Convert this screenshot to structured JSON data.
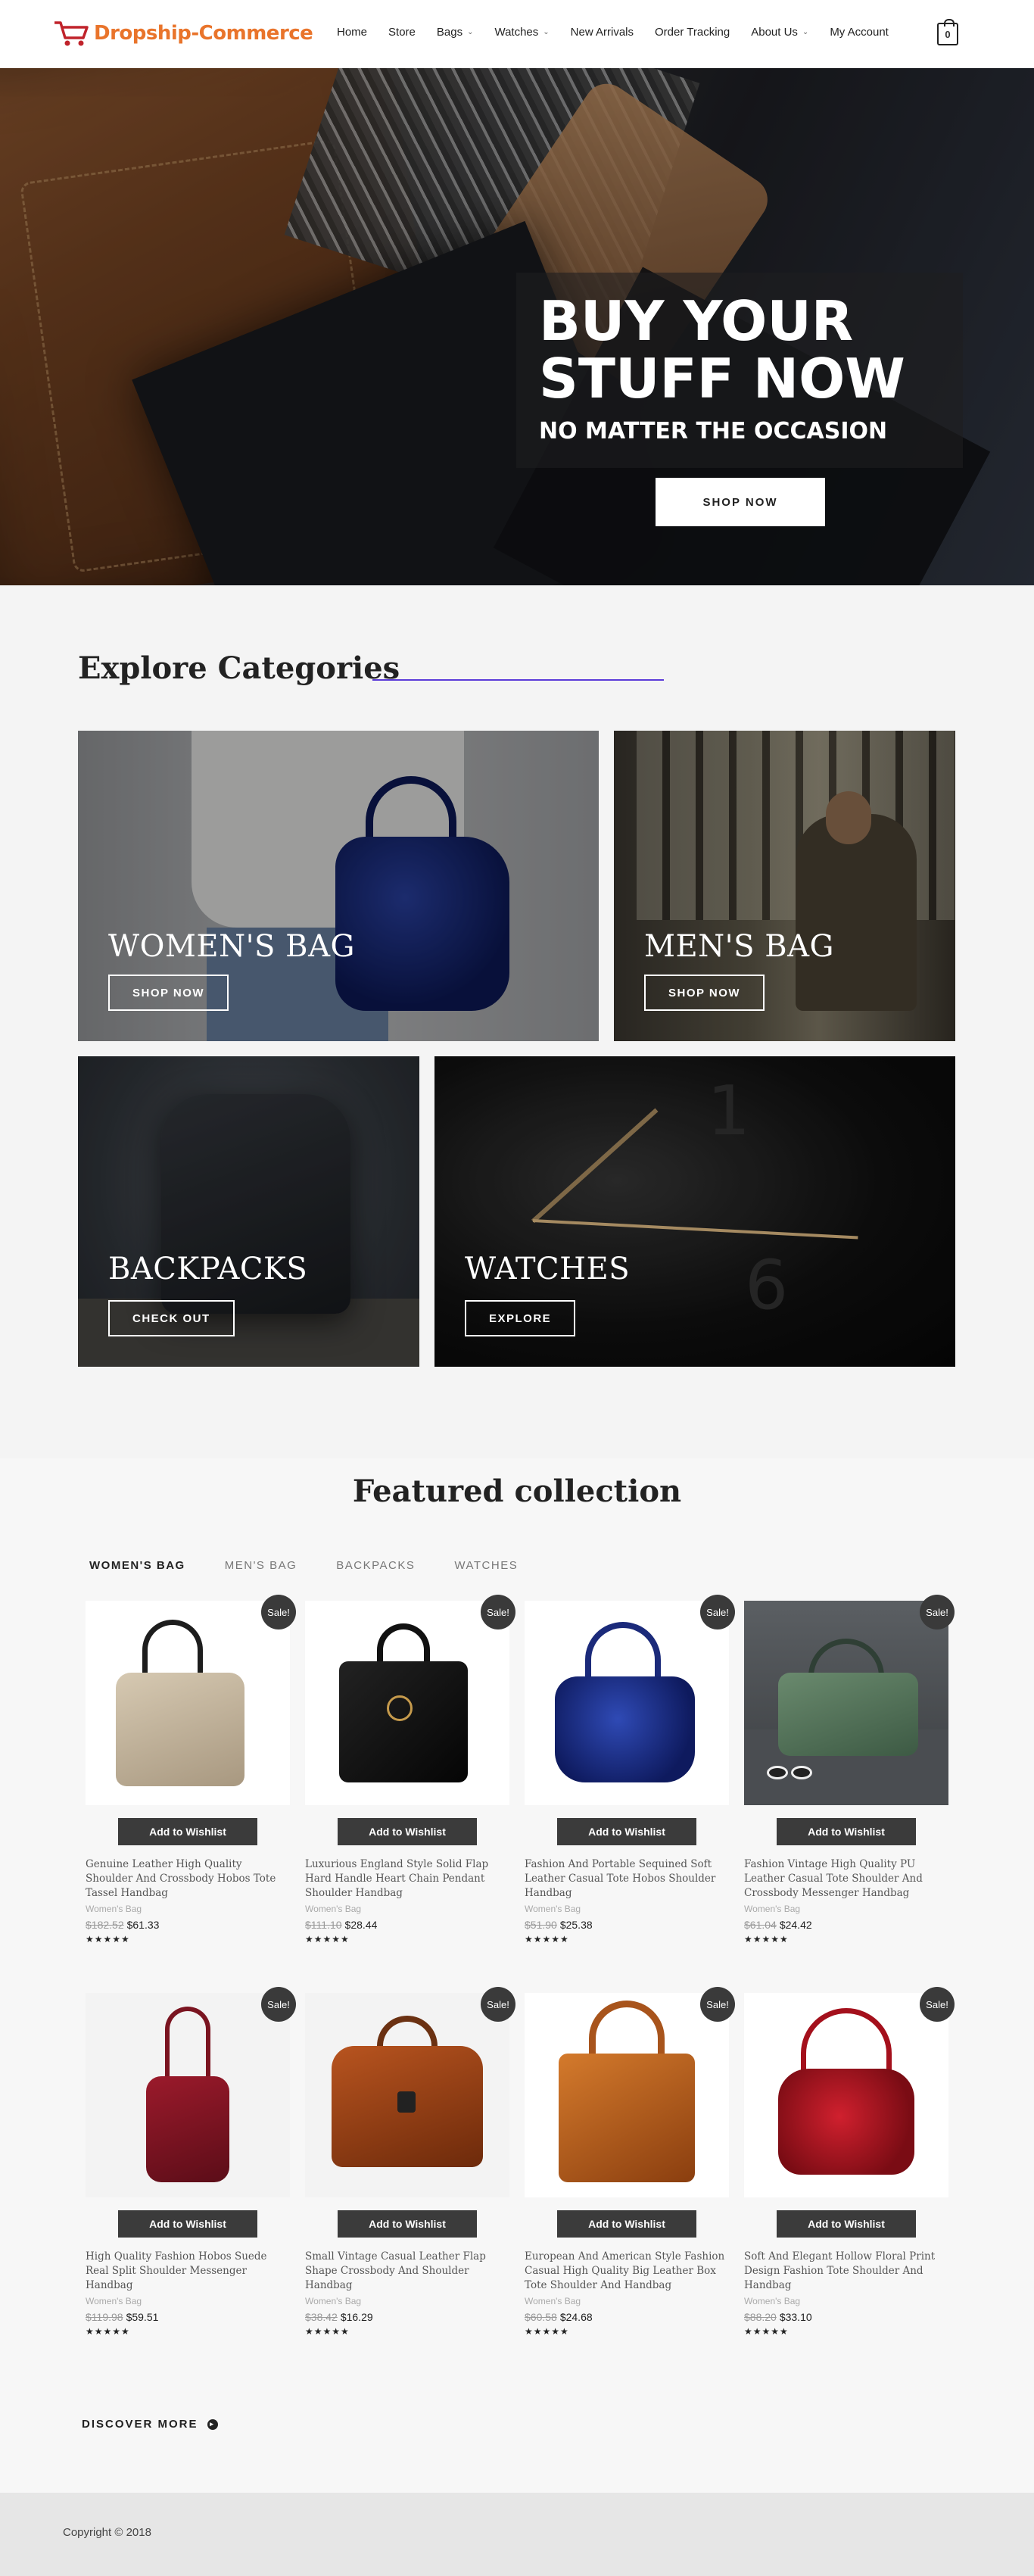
{
  "brand": {
    "name": "Dropship-Commerce",
    "accent": "#e9742b"
  },
  "nav": {
    "items": [
      {
        "label": "Home",
        "dropdown": false
      },
      {
        "label": "Store",
        "dropdown": false
      },
      {
        "label": "Bags",
        "dropdown": true
      },
      {
        "label": "Watches",
        "dropdown": true
      },
      {
        "label": "New Arrivals",
        "dropdown": false
      },
      {
        "label": "Order Tracking",
        "dropdown": false
      },
      {
        "label": "About Us",
        "dropdown": true
      },
      {
        "label": "My Account",
        "dropdown": false
      }
    ],
    "cart_count": "0"
  },
  "hero": {
    "title": "BUY YOUR STUFF NOW",
    "subtitle": "NO MATTER THE OCCASION",
    "button": "SHOP NOW"
  },
  "categories": {
    "heading": "Explore Categories",
    "accent_line": "#5b3bd9",
    "items": [
      {
        "name": "WOMEN'S BAG",
        "button": "SHOP NOW"
      },
      {
        "name": "MEN'S BAG",
        "button": "SHOP NOW"
      },
      {
        "name": "BACKPACKS",
        "button": "CHECK OUT"
      },
      {
        "name": "WATCHES",
        "button": "EXPLORE"
      }
    ]
  },
  "featured": {
    "title": "Featured collection",
    "tabs": [
      "WOMEN'S BAG",
      "MEN'S BAG",
      "BACKPACKS",
      "WATCHES"
    ],
    "active_tab": 0,
    "sale_label": "Sale!",
    "wishlist_label": "Add to Wishlist",
    "products": [
      {
        "name": "Genuine Leather High Quality Shoulder And Crossbody Hobos Tote Tassel Handbag",
        "category": "Women's Bag",
        "old_price": "$182.52",
        "price": "$61.33",
        "rating": "★★★★★"
      },
      {
        "name": "Luxurious England Style Solid Flap Hard Handle Heart Chain Pendant Shoulder Handbag",
        "category": "Women's Bag",
        "old_price": "$111.10",
        "price": "$28.44",
        "rating": "★★★★★"
      },
      {
        "name": "Fashion And Portable Sequined Soft Leather Casual Tote Hobos Shoulder Handbag",
        "category": "Women's Bag",
        "old_price": "$51.90",
        "price": "$25.38",
        "rating": "★★★★★"
      },
      {
        "name": "Fashion Vintage High Quality PU Leather Casual Tote Shoulder And Crossbody Messenger Handbag",
        "category": "Women's Bag",
        "old_price": "$61.04",
        "price": "$24.42",
        "rating": "★★★★★"
      },
      {
        "name": "High Quality Fashion Hobos Suede Real Split Shoulder Messenger Handbag",
        "category": "Women's Bag",
        "old_price": "$119.98",
        "price": "$59.51",
        "rating": "★★★★★"
      },
      {
        "name": "Small Vintage Casual Leather Flap Shape Crossbody And Shoulder Handbag",
        "category": "Women's Bag",
        "old_price": "$38.42",
        "price": "$16.29",
        "rating": "★★★★★"
      },
      {
        "name": "European And American Style Fashion Casual High Quality Big Leather Box Tote Shoulder And Handbag",
        "category": "Women's Bag",
        "old_price": "$60.58",
        "price": "$24.68",
        "rating": "★★★★★"
      },
      {
        "name": "Soft And Elegant Hollow Floral Print Design Fashion Tote Shoulder And Handbag",
        "category": "Women's Bag",
        "old_price": "$88.20",
        "price": "$33.10",
        "rating": "★★★★★"
      }
    ],
    "discover": "DISCOVER MORE"
  },
  "footer": {
    "copyright": "Copyright © 2018"
  }
}
